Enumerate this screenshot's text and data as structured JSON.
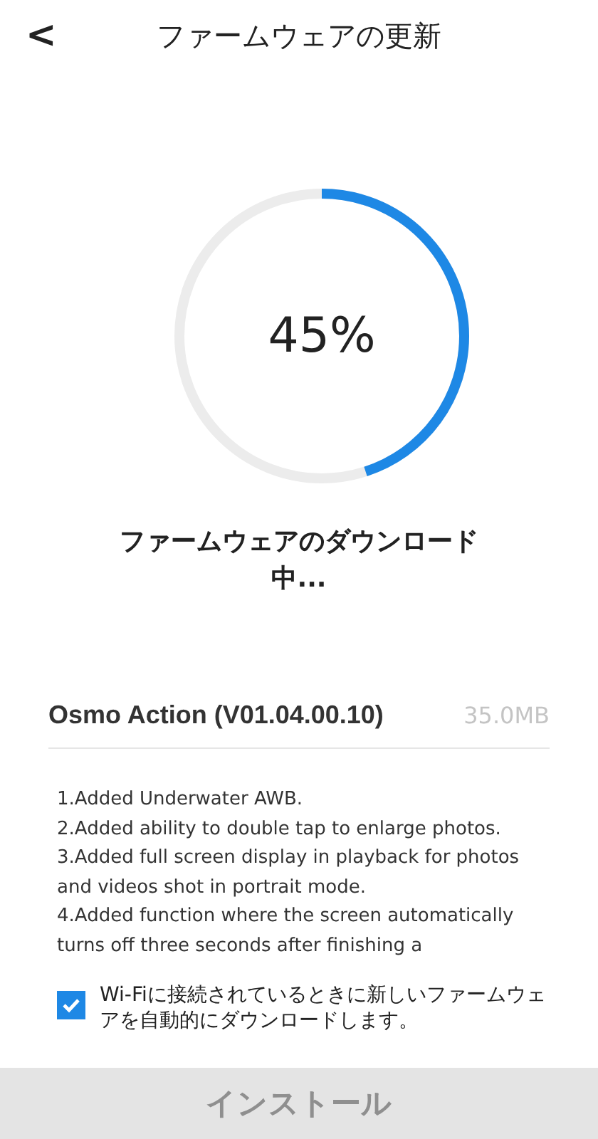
{
  "header": {
    "back": "<",
    "title": "ファームウェアの更新"
  },
  "progress": {
    "level": 0.45,
    "reading": "45%",
    "status": "ファームウェアのダウンロード中..."
  },
  "firmware": {
    "name": "Osmo Action (V01.04.00.10)",
    "size": "35.0MB"
  },
  "notes": [
    "1.Added Underwater AWB.",
    "2.Added ability to double tap to enlarge photos.",
    "3.Added full screen display in playback for photos and videos shot in portrait mode.",
    "4.Added function where the screen automatically turns off three seconds after finishing a"
  ],
  "auto_download": {
    "checked": true,
    "label": "Wi-Fiに接続されているときに新しいファームウェアを自動的にダウンロードします。"
  },
  "install_button": {
    "label": "インストール",
    "disabled": true
  }
}
